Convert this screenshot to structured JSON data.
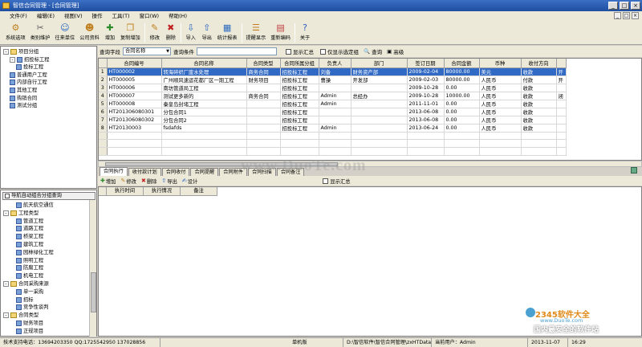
{
  "window": {
    "title": "智信合同管理 - [合同管理]",
    "controls": [
      "_",
      "□",
      "×"
    ]
  },
  "menu": [
    "文件(F)",
    "编辑(E)",
    "视图(V)",
    "操作",
    "工具(T)",
    "窗口(W)",
    "帮助(H)"
  ],
  "toolbar": [
    {
      "label": "系统选项",
      "icon": "settings-icon",
      "glyph": "⚙"
    },
    {
      "label": "类别维护",
      "icon": "tools-icon",
      "glyph": "✂"
    },
    {
      "label": "往来单位",
      "icon": "contacts-icon",
      "glyph": "☺"
    },
    {
      "label": "公司资料",
      "icon": "company-icon",
      "glyph": "☻"
    },
    {
      "label": "增加",
      "icon": "add-icon",
      "glyph": "✚"
    },
    {
      "label": "复制增加",
      "icon": "copy-add-icon",
      "glyph": "❐"
    },
    {
      "label": "修改",
      "icon": "edit-icon",
      "glyph": "✎"
    },
    {
      "label": "删除",
      "icon": "delete-icon",
      "glyph": "✖"
    },
    {
      "label": "导入",
      "icon": "import-icon",
      "glyph": "⇩"
    },
    {
      "label": "导出",
      "icon": "export-icon",
      "glyph": "⇧"
    },
    {
      "label": "统计报表",
      "icon": "report-icon",
      "glyph": "▦"
    },
    {
      "label": "提醒显示",
      "icon": "reminder-icon",
      "glyph": "☰"
    },
    {
      "label": "重新编码",
      "icon": "recode-icon",
      "glyph": "▤"
    },
    {
      "label": "关于",
      "icon": "help-icon",
      "glyph": "?"
    }
  ],
  "tree_top": [
    {
      "label": "项目分组",
      "level": 0,
      "expander": "-"
    },
    {
      "label": "招投标工程",
      "level": 1,
      "expander": "-"
    },
    {
      "label": "投标工程",
      "level": 2,
      "expander": ""
    },
    {
      "label": "普通用户工程",
      "level": 1,
      "expander": ""
    },
    {
      "label": "内部自行工程",
      "level": 1,
      "expander": ""
    },
    {
      "label": "其他工程",
      "level": 1,
      "expander": ""
    },
    {
      "label": "购销合同",
      "level": 1,
      "expander": ""
    },
    {
      "label": "测试分组",
      "level": 1,
      "expander": ""
    }
  ],
  "tree_bottom_header": "导航自动组合分组查询",
  "tree_bottom": [
    {
      "label": "航天航空通信",
      "level": 2,
      "expander": ""
    },
    {
      "label": "工程类型",
      "level": 0,
      "expander": "-"
    },
    {
      "label": "管道工程",
      "level": 2,
      "expander": ""
    },
    {
      "label": "道路工程",
      "level": 2,
      "expander": ""
    },
    {
      "label": "桥梁工程",
      "level": 2,
      "expander": ""
    },
    {
      "label": "建筑工程",
      "level": 2,
      "expander": ""
    },
    {
      "label": "园林绿化工程",
      "level": 2,
      "expander": ""
    },
    {
      "label": "照明工程",
      "level": 2,
      "expander": ""
    },
    {
      "label": "防腐工程",
      "level": 2,
      "expander": ""
    },
    {
      "label": "机电工程",
      "level": 2,
      "expander": ""
    },
    {
      "label": "合同采购来源",
      "level": 0,
      "expander": "-"
    },
    {
      "label": "单一采购",
      "level": 2,
      "expander": ""
    },
    {
      "label": "招标",
      "level": 2,
      "expander": ""
    },
    {
      "label": "竞争性谈判",
      "level": 2,
      "expander": ""
    },
    {
      "label": "合同类型",
      "level": 0,
      "expander": "-"
    },
    {
      "label": "财务项目",
      "level": 2,
      "expander": ""
    },
    {
      "label": "正规项目",
      "level": 2,
      "expander": ""
    }
  ],
  "query": {
    "field_label": "查询字段",
    "field_value": "合同名称",
    "condition_label": "查询条件",
    "condition_value": "",
    "show_summary": "显示汇总",
    "show_only_selected": "仅显示选定组",
    "query_button": "查询",
    "advanced_button": "高级"
  },
  "grid": {
    "columns": [
      "合同编号",
      "合同名称",
      "合同类型",
      "合同所属分组",
      "负责人",
      "部门",
      "签订日期",
      "合同金额",
      "币种",
      "收付方向",
      ""
    ],
    "rows": [
      [
        "HT000002",
        "转海碎织厂废水处理",
        "商务合同",
        "招投标工程",
        "刘备",
        "财务资产部",
        "2009-02-04",
        "80000.00",
        "美元",
        "收款",
        "开"
      ],
      [
        "HT000005",
        "广州顺风速运花都厂区一期工程",
        "财务项目",
        "招投标工程",
        "曹操",
        "开发部",
        "2009-02-03",
        "80000.00",
        "人民币",
        "付款",
        "开"
      ],
      [
        "HT000006",
        "南坊管道局工程",
        "",
        "招投标工程",
        "",
        "",
        "2009-10-28",
        "0.00",
        "人民币",
        "收款",
        ""
      ],
      [
        "HT000007",
        "测试更多新的",
        "商务合同",
        "招投标工程",
        "Admin",
        "总经办",
        "2009-10-28",
        "10000.00",
        "人民币",
        "收款",
        "闭"
      ],
      [
        "HT000008",
        "秦皇岛封堵工程",
        "",
        "招投标工程",
        "Admin",
        "",
        "2011-11-01",
        "0.00",
        "人民币",
        "收款",
        ""
      ],
      [
        "HT201306080301",
        "分包合同1",
        "",
        "招投标工程",
        "",
        "",
        "2013-06-08",
        "0.00",
        "人民币",
        "收款",
        ""
      ],
      [
        "HT201306080302",
        "分包合同2",
        "",
        "招投标工程",
        "",
        "",
        "2013-06-08",
        "0.00",
        "人民币",
        "收款",
        ""
      ],
      [
        "HT20130003",
        "fsdafds",
        "",
        "招投标工程",
        "Admin",
        "",
        "2013-06-24",
        "0.00",
        "人民币",
        "收款",
        ""
      ]
    ],
    "selected_row": 1
  },
  "tabs": [
    "合同执行",
    "收付款计划",
    "合同收付",
    "合同提醒",
    "合同附件",
    "合同扫描",
    "合同备注"
  ],
  "active_tab": 0,
  "subtoolbar": {
    "add": "增加",
    "edit": "修改",
    "delete": "删除",
    "export": "导出",
    "design": "设计",
    "show_summary": "显示汇总"
  },
  "subgrid_columns": [
    "执行时间",
    "执行情况",
    "备注"
  ],
  "status": {
    "support": "技术支持电话：13694203350 QQ:1725542950 137028856",
    "mode": "单机版",
    "path": "D:\\智信软件\\智信合同管理\\zxHTData.sys",
    "user": "当前用户：Admin",
    "date": "2013-11-07",
    "time": "16:29"
  },
  "watermarks": {
    "center": "www.DuoTe.com",
    "brand": "2345软件大全",
    "brand_url": "www.DuoTe.com",
    "slogan": "国内最安全的软件站"
  }
}
